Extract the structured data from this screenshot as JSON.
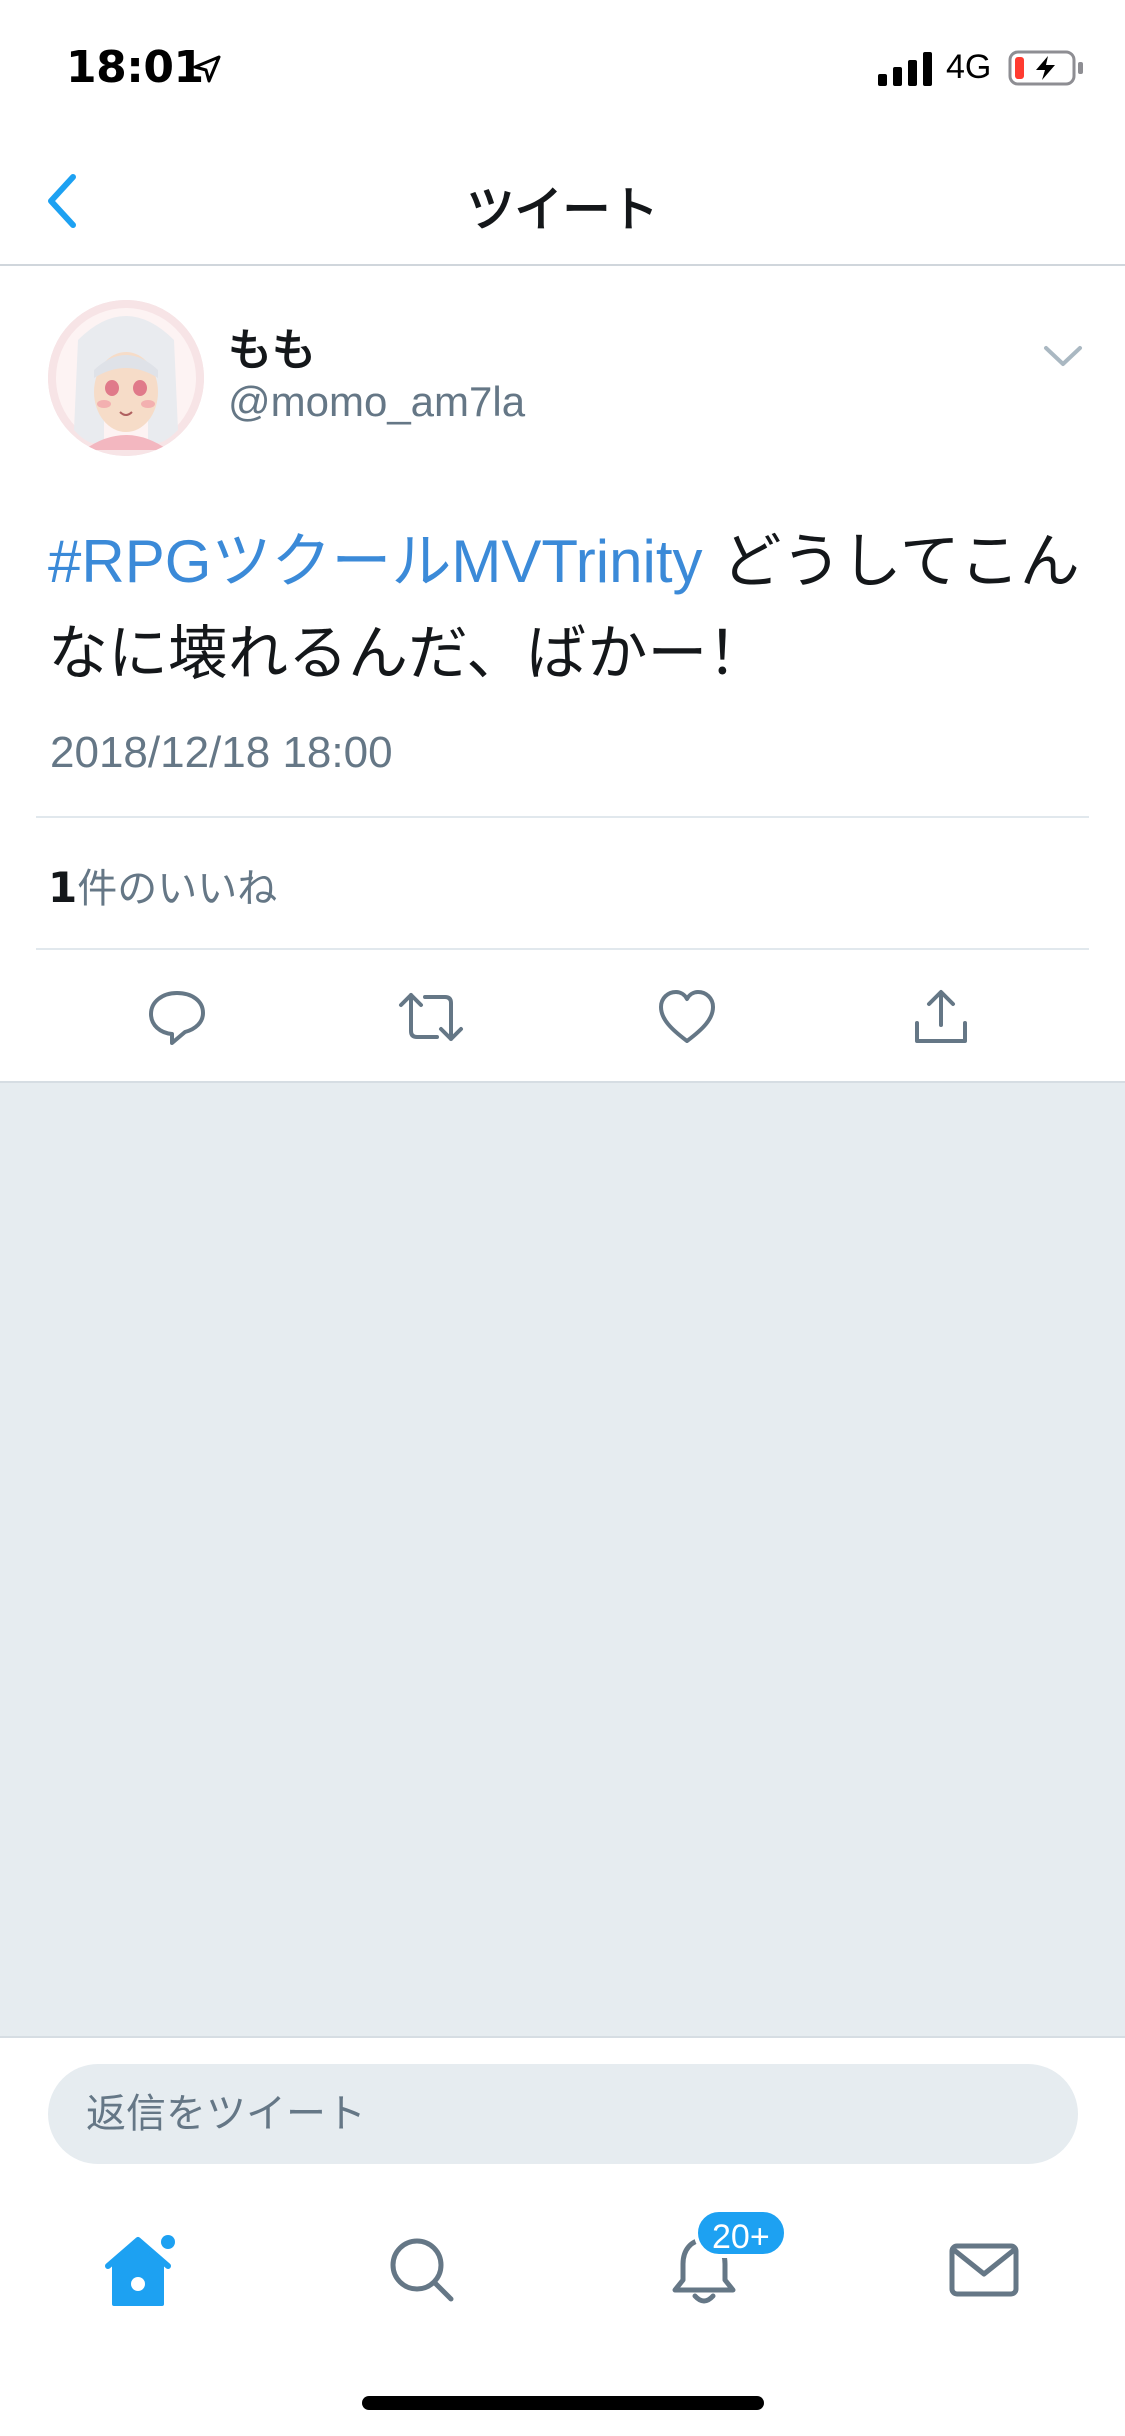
{
  "status_bar": {
    "time": "18:01",
    "network": "4G",
    "icons": [
      "location-arrow-icon",
      "signal-icon",
      "battery-charging-icon"
    ]
  },
  "nav": {
    "title": "ツイート",
    "back_icon": "chevron-left-icon"
  },
  "tweet": {
    "display_name": "もも",
    "handle": "@momo_am7la",
    "hashtag": "#RPGツクールMVTrinity",
    "text": " どうしてこんなに壊れるんだ、ばかー！",
    "timestamp": "2018/12/18 18:00",
    "likes_count": "1",
    "likes_label": "件のいいね",
    "actions": [
      "reply-icon",
      "retweet-icon",
      "like-icon",
      "share-icon"
    ]
  },
  "reply": {
    "placeholder": "返信をツイート"
  },
  "tab_bar": {
    "tabs": [
      "home-icon",
      "search-icon",
      "notifications-icon",
      "messages-icon"
    ],
    "notifications_badge": "20+"
  },
  "colors": {
    "accent": "#1da1f2",
    "hashtag": "#3b8ad8",
    "secondary_text": "#657786",
    "background_gray": "#e6ecf0"
  }
}
